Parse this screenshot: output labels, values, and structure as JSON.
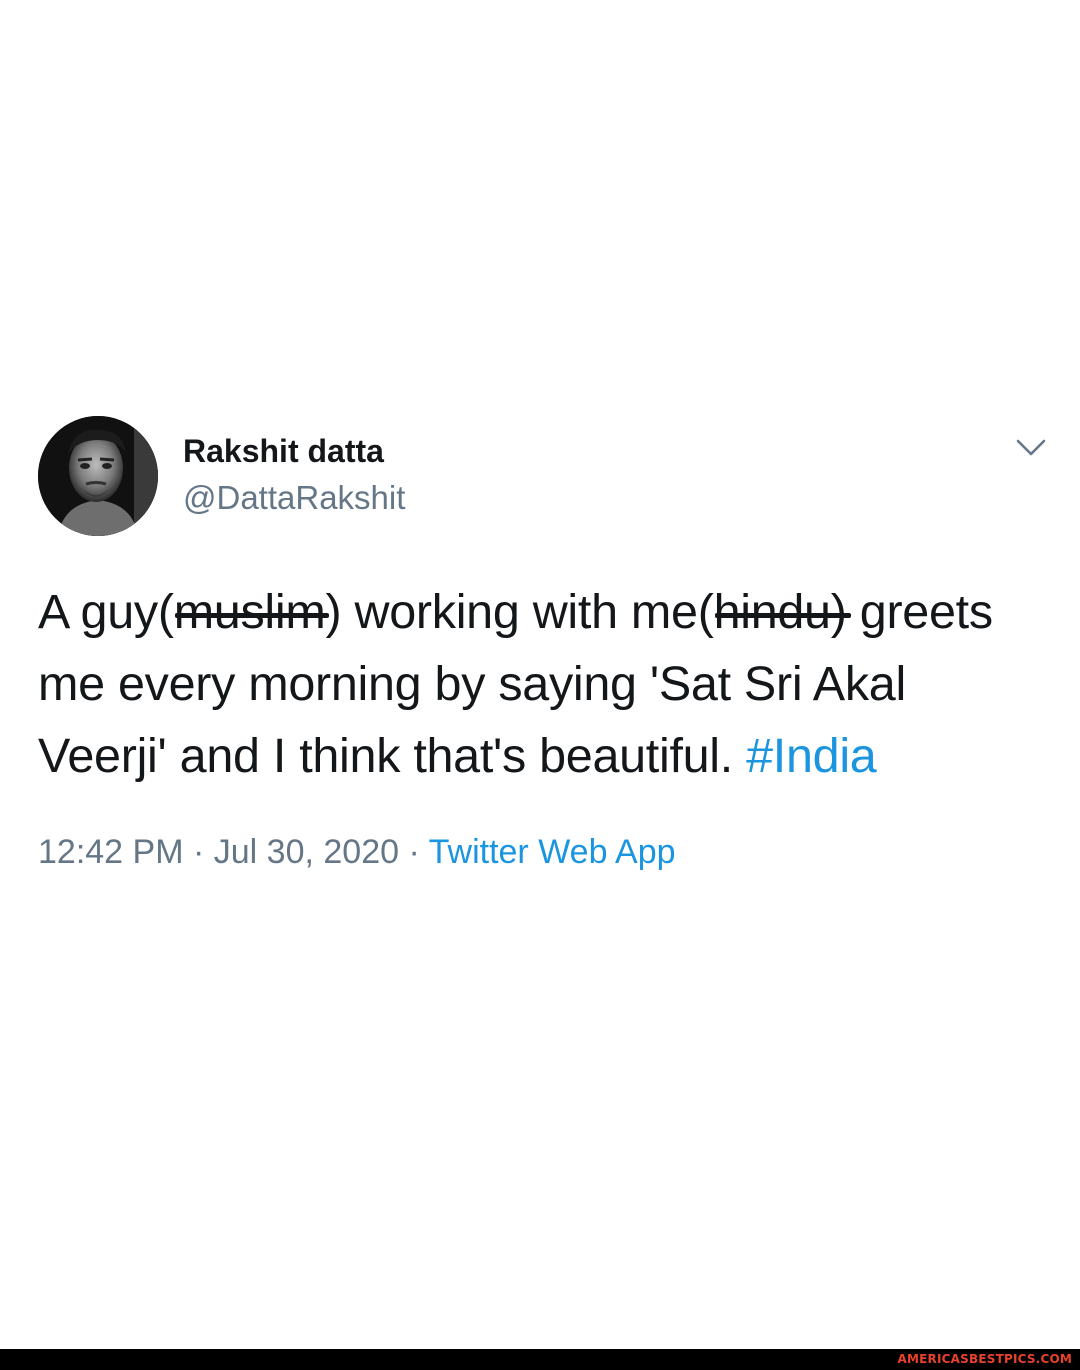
{
  "user": {
    "display_name": "Rakshit datta",
    "handle": "@DattaRakshit",
    "avatar_icon": "profile-photo"
  },
  "menu": {
    "caret_icon": "chevron-down-icon"
  },
  "tweet": {
    "text_part1": "A guy(",
    "struck1": "muslim",
    "text_part2": ") working with me(",
    "struck2": "hindu)",
    "text_part3": " greets me every morning by saying 'Sat Sri Akal Veerji' and I think that's beautiful. ",
    "hashtag": "#India"
  },
  "meta": {
    "time": "12:42 PM",
    "separator1": " · ",
    "date": "Jul 30, 2020",
    "separator2": " · ",
    "source": "Twitter Web App"
  },
  "footer": {
    "watermark": "AMERICASBESTPICS.COM"
  },
  "colors": {
    "text": "#14171a",
    "secondary": "#657786",
    "link": "#1b95e0",
    "watermark": "#e8412c"
  }
}
